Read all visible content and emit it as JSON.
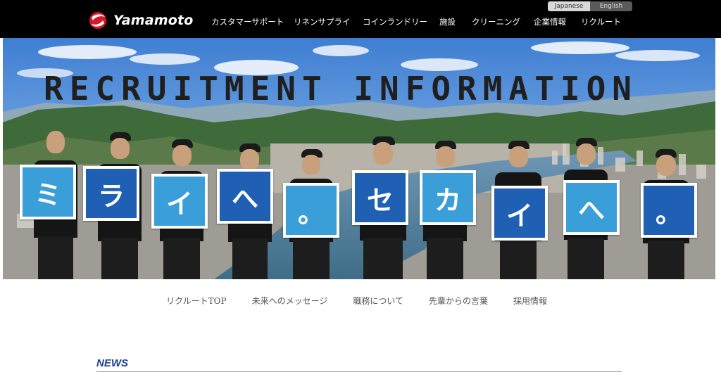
{
  "header": {
    "logo_text": "Yamamoto",
    "nav": [
      "カスタマーサポート",
      "リネンサプライ",
      "コインランドリー",
      "施設",
      "クリーニング",
      "企業情報",
      "リクルート"
    ],
    "languages": {
      "japanese": "Japanese",
      "english": "English"
    }
  },
  "hero": {
    "title": "RECRUITMENT INFORMATION",
    "signs": [
      "ミ",
      "ラ",
      "イ",
      "へ",
      "。",
      "セ",
      "カ",
      "イ",
      "へ",
      "。"
    ]
  },
  "subnav": [
    "リクルートTOP",
    "未来へのメッセージ",
    "職務について",
    "先輩からの言葉",
    "採用情報"
  ],
  "news": {
    "title": "NEWS"
  },
  "colors": {
    "header_bg": "#000000",
    "sign_light": "#3a9fd8",
    "sign_dark": "#1f5fb4",
    "news_blue": "#1d3f8f",
    "logo_red": "#d7182a"
  },
  "icons": {
    "logo": "yamamoto-logo-mark"
  }
}
